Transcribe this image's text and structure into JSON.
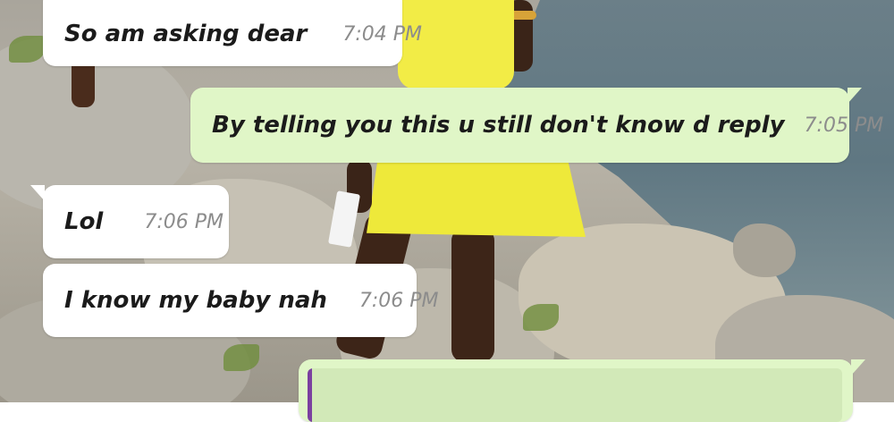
{
  "chat": {
    "messages": [
      {
        "direction": "incoming",
        "text": "So am asking dear",
        "time": "7:04 PM"
      },
      {
        "direction": "outgoing",
        "text": "By telling you this u still don't know d reply",
        "time": "7:05 PM",
        "status": "read"
      },
      {
        "direction": "incoming",
        "text": "Lol",
        "time": "7:06 PM"
      },
      {
        "direction": "incoming",
        "text": "I know my baby nah",
        "time": "7:06 PM"
      },
      {
        "direction": "outgoing",
        "type": "reply-quote",
        "quote_text": ""
      }
    ],
    "read_receipt_glyph": "✓✓"
  },
  "colors": {
    "incoming_bubble": "#ffffff",
    "outgoing_bubble": "#e0f6c7",
    "timestamp": "#8c8c8c",
    "quote_accent": "#7b3fa0"
  },
  "icons": [
    "double-check-icon"
  ]
}
